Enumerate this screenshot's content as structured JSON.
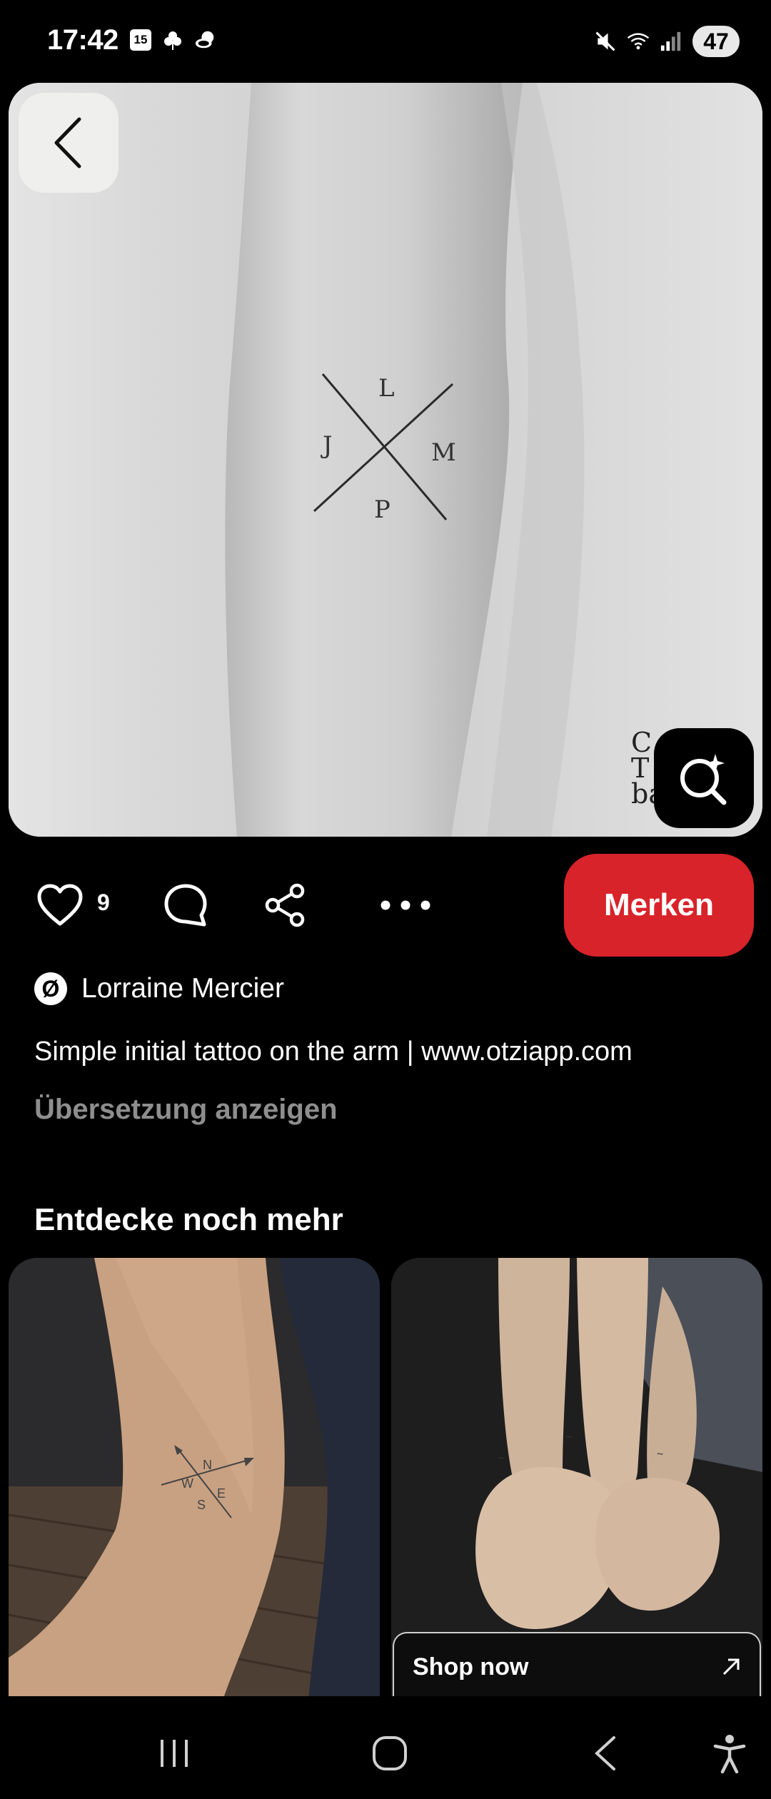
{
  "status_bar": {
    "time": "17:42",
    "calendar_day": "15",
    "battery": "47",
    "icons": [
      "calendar-icon",
      "clover-icon",
      "weather-icon",
      "mute-icon",
      "wifi-icon",
      "signal-icon",
      "battery-icon"
    ]
  },
  "pin": {
    "image_description": "forearm tattoo, letters",
    "tattoo_letters": [
      "L",
      "J",
      "M",
      "P"
    ],
    "watermark": "C T ba",
    "like_count": "9",
    "save_label": "Merken",
    "creator_initial": "Ø",
    "creator_name": "Lorraine Mercier",
    "title": "Simple initial tattoo on the arm | www.otziapp.com",
    "translate_label": "Übersetzung anzeigen"
  },
  "more": {
    "section_title": "Entdecke noch mehr",
    "card_left_letters": [
      "N",
      "W",
      "E",
      "S"
    ],
    "shop_now_label": "Shop now"
  },
  "colors": {
    "background": "#000000",
    "accent_red": "#d8232a",
    "muted_text": "#8e8e8e"
  }
}
